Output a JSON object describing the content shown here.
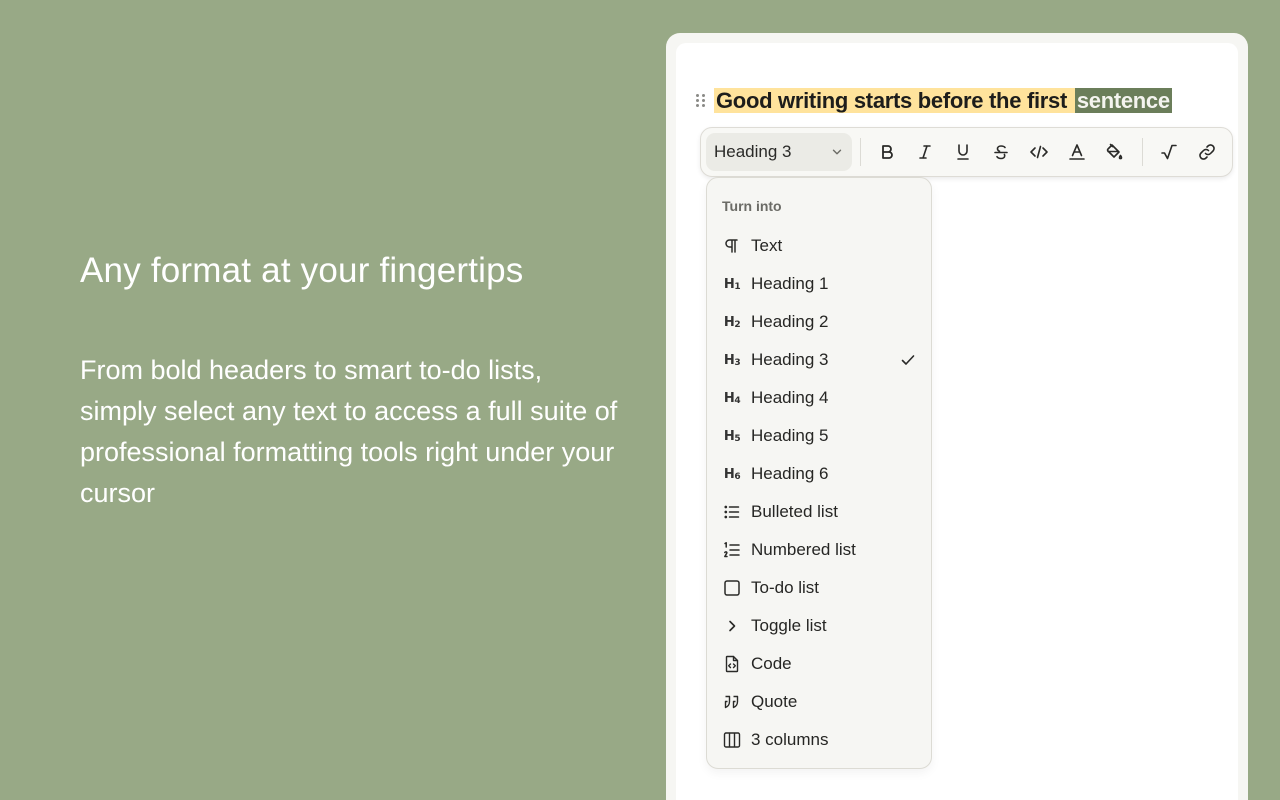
{
  "marketing": {
    "headline": "Any format at your fingertips",
    "body": "From bold headers to smart to-do lists, simply select any text to access a full suite of professional formatting tools right under your cursor"
  },
  "editor": {
    "heading": {
      "plain": "Good writing starts before the first ",
      "selected": "sentence"
    },
    "toolbar": {
      "block_type": "Heading 3",
      "buttons": [
        "bold-icon",
        "italic-icon",
        "underline-icon",
        "strikethrough-icon",
        "code-icon",
        "text-color-icon",
        "highlight-icon",
        "math-icon",
        "link-icon"
      ]
    },
    "menu": {
      "title": "Turn into",
      "selected": "Heading 3",
      "items": [
        {
          "label": "Text",
          "icon": "paragraph-icon"
        },
        {
          "label": "Heading 1",
          "icon": "h1-icon"
        },
        {
          "label": "Heading 2",
          "icon": "h2-icon"
        },
        {
          "label": "Heading 3",
          "icon": "h3-icon"
        },
        {
          "label": "Heading 4",
          "icon": "h4-icon"
        },
        {
          "label": "Heading 5",
          "icon": "h5-icon"
        },
        {
          "label": "Heading 6",
          "icon": "h6-icon"
        },
        {
          "label": "Bulleted list",
          "icon": "bulleted-list-icon"
        },
        {
          "label": "Numbered list",
          "icon": "numbered-list-icon"
        },
        {
          "label": "To-do list",
          "icon": "checkbox-icon"
        },
        {
          "label": "Toggle list",
          "icon": "chevron-right-icon"
        },
        {
          "label": "Code",
          "icon": "code-file-icon"
        },
        {
          "label": "Quote",
          "icon": "quote-icon"
        },
        {
          "label": "3 columns",
          "icon": "columns-icon"
        }
      ]
    }
  },
  "colors": {
    "background": "#98a986",
    "highlight": "#ffe39c",
    "selection": "#6b7e5a"
  }
}
